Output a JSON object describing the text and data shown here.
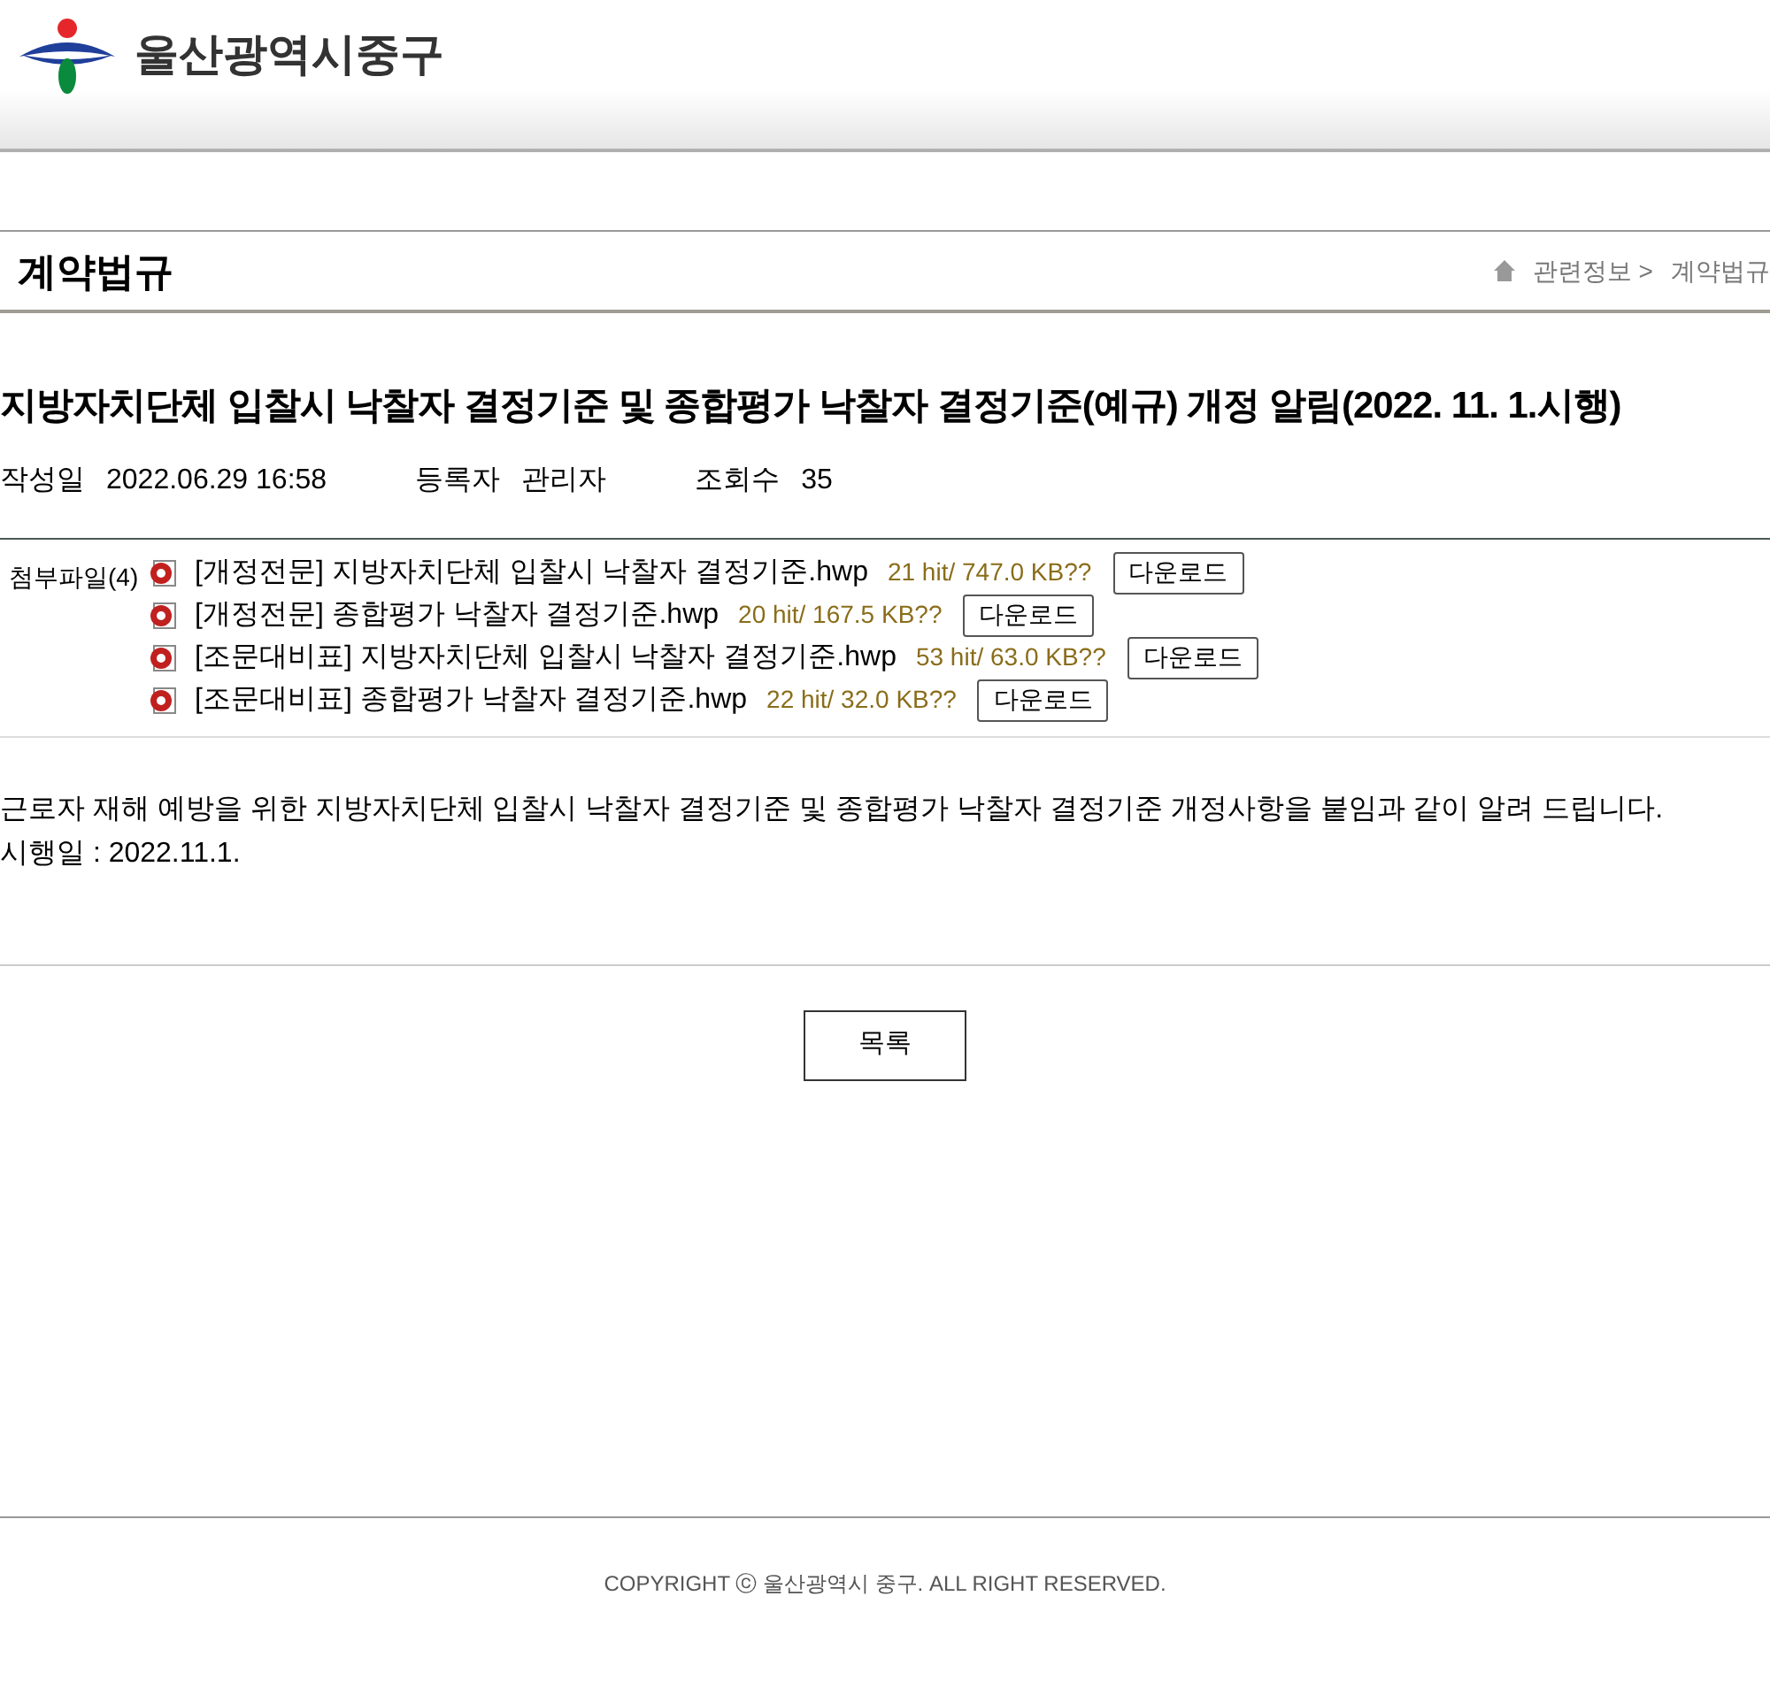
{
  "header": {
    "site_name": "울산광역시중구"
  },
  "page": {
    "title": "계약법규",
    "breadcrumb": [
      "관련정보 >",
      "계약법규"
    ]
  },
  "post": {
    "title": "지방자치단체 입찰시 낙찰자 결정기준 및 종합평가 낙찰자 결정기준(예규) 개정 알림(2022. 11. 1.시행)",
    "meta": [
      {
        "label": "작성일",
        "value": "2022.06.29 16:58"
      },
      {
        "label": "등록자",
        "value": "관리자"
      },
      {
        "label": "조회수",
        "value": "35"
      }
    ],
    "attachments_label": "첨부파일(4)",
    "attachments": [
      {
        "name": "[개정전문] 지방자치단체 입찰시 낙찰자 결정기준.hwp",
        "info": "21 hit/ 747.0 KB??",
        "button": "다운로드"
      },
      {
        "name": "[개정전문] 종합평가 낙찰자 결정기준.hwp",
        "info": "20 hit/ 167.5 KB??",
        "button": "다운로드"
      },
      {
        "name": "[조문대비표] 지방자치단체 입찰시 낙찰자 결정기준.hwp",
        "info": "53 hit/ 63.0 KB??",
        "button": "다운로드"
      },
      {
        "name": "[조문대비표] 종합평가 낙찰자 결정기준.hwp",
        "info": "22 hit/ 32.0 KB??",
        "button": "다운로드"
      }
    ],
    "body": [
      "근로자 재해 예방을 위한 지방자치단체 입찰시 낙찰자 결정기준 및 종합평가 낙찰자 결정기준 개정사항을 붙임과 같이 알려 드립니다.",
      "시행일 : 2022.11.1."
    ],
    "list_button": "목록"
  },
  "footer": {
    "copyright": "COPYRIGHT ⓒ 울산광역시 중구. ALL RIGHT RESERVED."
  }
}
